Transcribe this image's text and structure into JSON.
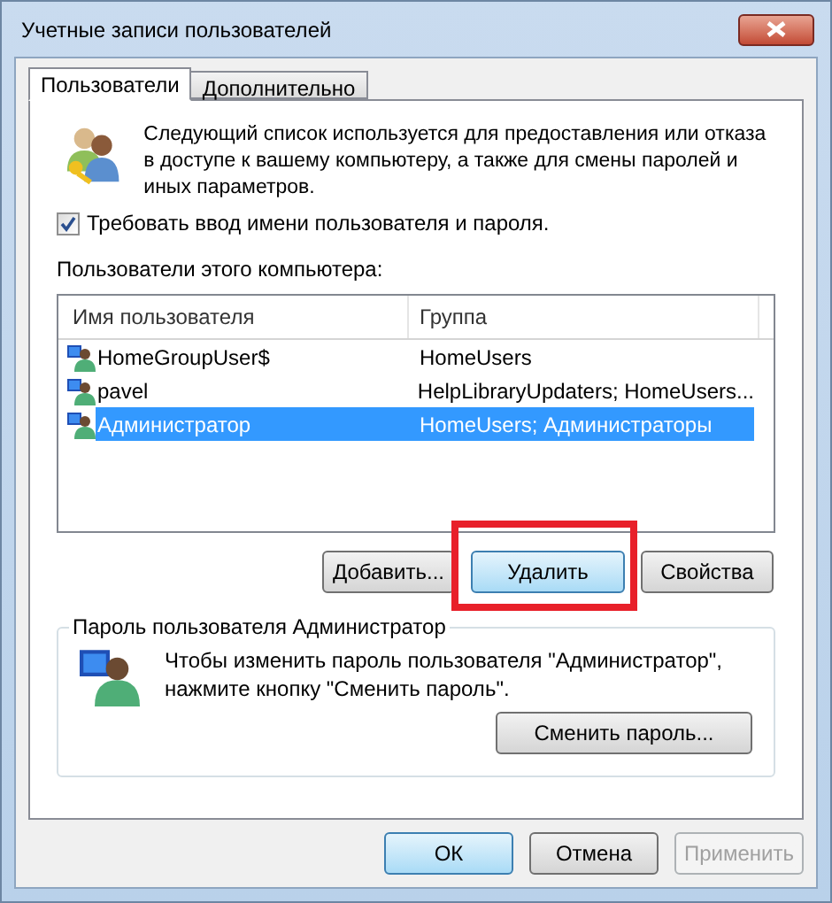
{
  "window": {
    "title": "Учетные записи пользователей"
  },
  "tabs": [
    {
      "label": "Пользователи",
      "selected": true
    },
    {
      "label": "Дополнительно",
      "selected": false
    }
  ],
  "intro": "Следующий список используется для предоставления или отказа в доступе к вашему компьютеру, а также для смены паролей и иных параметров.",
  "require_login": {
    "label": "Требовать ввод имени пользователя и пароля.",
    "checked": true
  },
  "users_label": "Пользователи этого компьютера:",
  "table": {
    "columns": [
      "Имя пользователя",
      "Группа"
    ],
    "rows": [
      {
        "name": "HomeGroupUser$",
        "group": "HomeUsers",
        "selected": false
      },
      {
        "name": "pavel",
        "group": "HelpLibraryUpdaters; HomeUsers...",
        "selected": false
      },
      {
        "name": "Администратор",
        "group": "HomeUsers; Администраторы",
        "selected": true
      }
    ]
  },
  "list_buttons": [
    {
      "label": "Добавить...",
      "highlighted": false
    },
    {
      "label": "Удалить",
      "highlighted": true
    },
    {
      "label": "Свойства",
      "highlighted": false
    }
  ],
  "password_group": {
    "title": "Пароль пользователя Администратор",
    "text": "Чтобы изменить пароль пользователя \"Администратор\", нажмите кнопку \"Сменить пароль\".",
    "button": "Сменить пароль..."
  },
  "dialog_buttons": [
    {
      "label": "ОК",
      "disabled": false,
      "default": true
    },
    {
      "label": "Отмена",
      "disabled": false,
      "default": false
    },
    {
      "label": "Применить",
      "disabled": true,
      "default": false
    }
  ]
}
